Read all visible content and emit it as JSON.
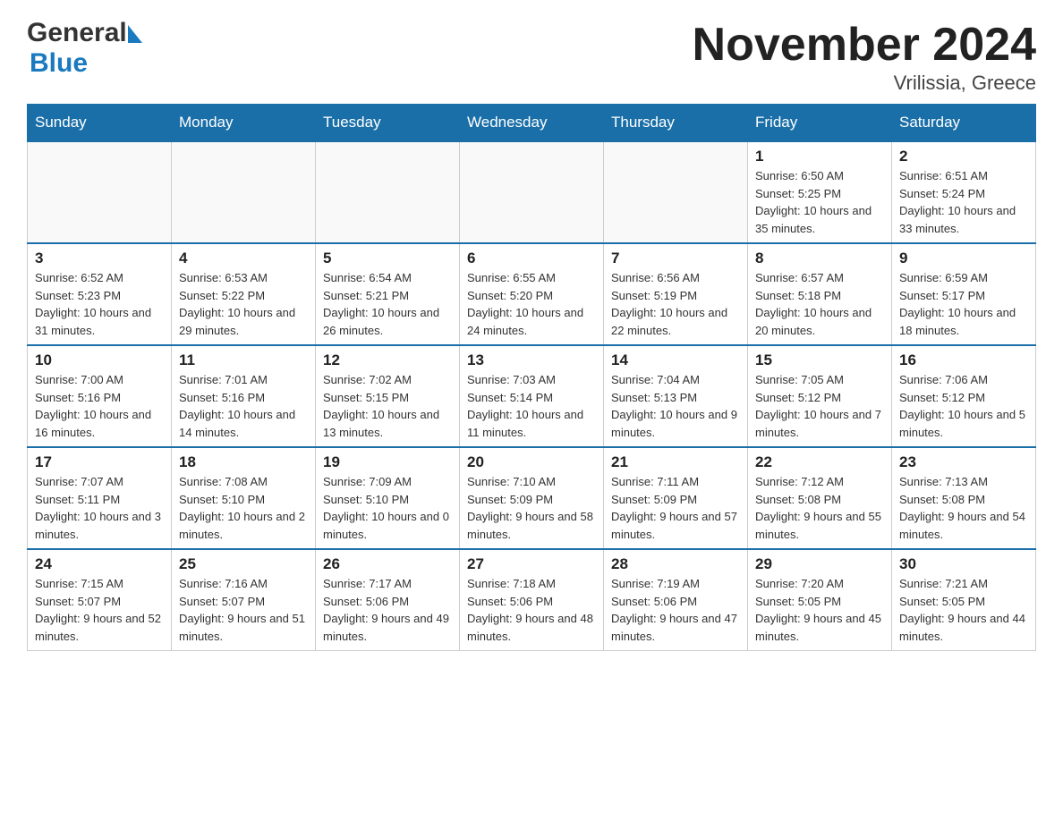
{
  "logo": {
    "general": "General",
    "blue": "Blue"
  },
  "header": {
    "title": "November 2024",
    "subtitle": "Vrilissia, Greece"
  },
  "calendar": {
    "days": [
      "Sunday",
      "Monday",
      "Tuesday",
      "Wednesday",
      "Thursday",
      "Friday",
      "Saturday"
    ],
    "weeks": [
      [
        {
          "num": "",
          "info": ""
        },
        {
          "num": "",
          "info": ""
        },
        {
          "num": "",
          "info": ""
        },
        {
          "num": "",
          "info": ""
        },
        {
          "num": "",
          "info": ""
        },
        {
          "num": "1",
          "info": "Sunrise: 6:50 AM\nSunset: 5:25 PM\nDaylight: 10 hours and 35 minutes."
        },
        {
          "num": "2",
          "info": "Sunrise: 6:51 AM\nSunset: 5:24 PM\nDaylight: 10 hours and 33 minutes."
        }
      ],
      [
        {
          "num": "3",
          "info": "Sunrise: 6:52 AM\nSunset: 5:23 PM\nDaylight: 10 hours and 31 minutes."
        },
        {
          "num": "4",
          "info": "Sunrise: 6:53 AM\nSunset: 5:22 PM\nDaylight: 10 hours and 29 minutes."
        },
        {
          "num": "5",
          "info": "Sunrise: 6:54 AM\nSunset: 5:21 PM\nDaylight: 10 hours and 26 minutes."
        },
        {
          "num": "6",
          "info": "Sunrise: 6:55 AM\nSunset: 5:20 PM\nDaylight: 10 hours and 24 minutes."
        },
        {
          "num": "7",
          "info": "Sunrise: 6:56 AM\nSunset: 5:19 PM\nDaylight: 10 hours and 22 minutes."
        },
        {
          "num": "8",
          "info": "Sunrise: 6:57 AM\nSunset: 5:18 PM\nDaylight: 10 hours and 20 minutes."
        },
        {
          "num": "9",
          "info": "Sunrise: 6:59 AM\nSunset: 5:17 PM\nDaylight: 10 hours and 18 minutes."
        }
      ],
      [
        {
          "num": "10",
          "info": "Sunrise: 7:00 AM\nSunset: 5:16 PM\nDaylight: 10 hours and 16 minutes."
        },
        {
          "num": "11",
          "info": "Sunrise: 7:01 AM\nSunset: 5:16 PM\nDaylight: 10 hours and 14 minutes."
        },
        {
          "num": "12",
          "info": "Sunrise: 7:02 AM\nSunset: 5:15 PM\nDaylight: 10 hours and 13 minutes."
        },
        {
          "num": "13",
          "info": "Sunrise: 7:03 AM\nSunset: 5:14 PM\nDaylight: 10 hours and 11 minutes."
        },
        {
          "num": "14",
          "info": "Sunrise: 7:04 AM\nSunset: 5:13 PM\nDaylight: 10 hours and 9 minutes."
        },
        {
          "num": "15",
          "info": "Sunrise: 7:05 AM\nSunset: 5:12 PM\nDaylight: 10 hours and 7 minutes."
        },
        {
          "num": "16",
          "info": "Sunrise: 7:06 AM\nSunset: 5:12 PM\nDaylight: 10 hours and 5 minutes."
        }
      ],
      [
        {
          "num": "17",
          "info": "Sunrise: 7:07 AM\nSunset: 5:11 PM\nDaylight: 10 hours and 3 minutes."
        },
        {
          "num": "18",
          "info": "Sunrise: 7:08 AM\nSunset: 5:10 PM\nDaylight: 10 hours and 2 minutes."
        },
        {
          "num": "19",
          "info": "Sunrise: 7:09 AM\nSunset: 5:10 PM\nDaylight: 10 hours and 0 minutes."
        },
        {
          "num": "20",
          "info": "Sunrise: 7:10 AM\nSunset: 5:09 PM\nDaylight: 9 hours and 58 minutes."
        },
        {
          "num": "21",
          "info": "Sunrise: 7:11 AM\nSunset: 5:09 PM\nDaylight: 9 hours and 57 minutes."
        },
        {
          "num": "22",
          "info": "Sunrise: 7:12 AM\nSunset: 5:08 PM\nDaylight: 9 hours and 55 minutes."
        },
        {
          "num": "23",
          "info": "Sunrise: 7:13 AM\nSunset: 5:08 PM\nDaylight: 9 hours and 54 minutes."
        }
      ],
      [
        {
          "num": "24",
          "info": "Sunrise: 7:15 AM\nSunset: 5:07 PM\nDaylight: 9 hours and 52 minutes."
        },
        {
          "num": "25",
          "info": "Sunrise: 7:16 AM\nSunset: 5:07 PM\nDaylight: 9 hours and 51 minutes."
        },
        {
          "num": "26",
          "info": "Sunrise: 7:17 AM\nSunset: 5:06 PM\nDaylight: 9 hours and 49 minutes."
        },
        {
          "num": "27",
          "info": "Sunrise: 7:18 AM\nSunset: 5:06 PM\nDaylight: 9 hours and 48 minutes."
        },
        {
          "num": "28",
          "info": "Sunrise: 7:19 AM\nSunset: 5:06 PM\nDaylight: 9 hours and 47 minutes."
        },
        {
          "num": "29",
          "info": "Sunrise: 7:20 AM\nSunset: 5:05 PM\nDaylight: 9 hours and 45 minutes."
        },
        {
          "num": "30",
          "info": "Sunrise: 7:21 AM\nSunset: 5:05 PM\nDaylight: 9 hours and 44 minutes."
        }
      ]
    ]
  }
}
